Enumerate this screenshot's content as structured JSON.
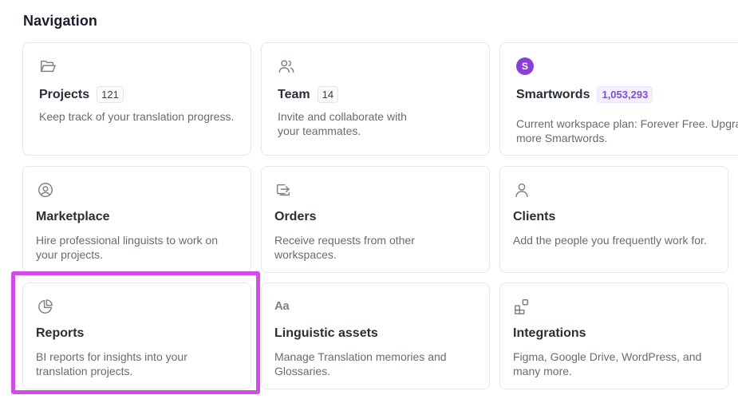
{
  "section": {
    "title": "Navigation"
  },
  "cards": {
    "projects": {
      "icon": "folder-open-icon",
      "title": "Projects",
      "badge": "121",
      "desc": "Keep track of your translation progress."
    },
    "team": {
      "icon": "users-icon",
      "title": "Team",
      "badge": "14",
      "desc": "Invite and collaborate with your teammates."
    },
    "smartwords": {
      "icon": "smartwords-avatar",
      "avatar_letter": "S",
      "title": "Smartwords",
      "badge": "1,053,293",
      "desc_line1": "Current workspace plan: Forever Free. Upgrade for",
      "desc_line2": "more Smartwords."
    },
    "marketplace": {
      "icon": "user-search-icon",
      "title": "Marketplace",
      "desc": "Hire professional linguists to work on your projects."
    },
    "orders": {
      "icon": "inbox-arrow-icon",
      "title": "Orders",
      "desc": "Receive requests from other workspaces."
    },
    "clients": {
      "icon": "user-icon",
      "title": "Clients",
      "desc": "Add the people you frequently work for."
    },
    "reports": {
      "icon": "pie-chart-icon",
      "title": "Reports",
      "desc": "BI reports for insights into your translation projects."
    },
    "linguistic": {
      "icon": "text-aa-icon",
      "icon_glyph": "Aa",
      "title": "Linguistic assets",
      "desc": "Manage Translation memories and Glossaries."
    },
    "integrations": {
      "icon": "apps-grid-icon",
      "title": "Integrations",
      "desc": "Figma, Google Drive, WordPress, and many more."
    }
  },
  "colors": {
    "highlight": "#cf4de6",
    "avatar": "#8a3fd8",
    "badge_accent": "#7b52c9"
  }
}
